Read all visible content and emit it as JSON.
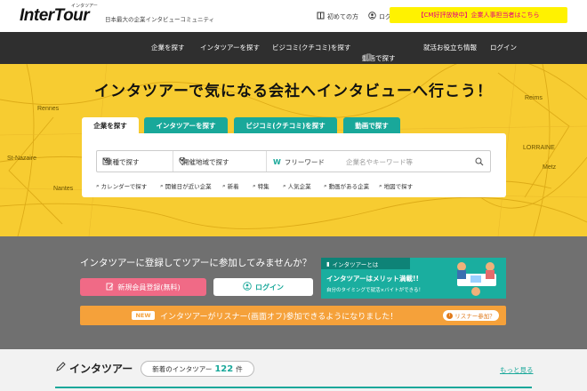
{
  "header": {
    "logo": "InterTour",
    "logo_sub": "インタツアー",
    "tagline": "日本最大の企業インタビューコミュニティ",
    "first_time": "初めての方",
    "login": "ログイン",
    "cm": "【CM好評放映中】企業人事担当者はこちら"
  },
  "nav": {
    "items": [
      "企業を探す",
      "インタツアーを探す",
      "ビジコミ(クチコミ)を探す",
      "動画で探す",
      "就活お役立ち情報",
      "ログイン"
    ]
  },
  "hero": {
    "headline": "インタツアーで気になる会社へインタビューへ行こう！",
    "tabs": [
      "企業を探す",
      "インタツアーを探す",
      "ビジコミ(クチコミ)を探す",
      "動画で探す"
    ],
    "industry": "業種で探す",
    "region": "開催地域で探す",
    "keyword": "フリーワード",
    "placeholder": "企業名やキーワード等",
    "quick_links": [
      "カレンダーで探す",
      "開催日が近い企業",
      "新着",
      "特集",
      "人気企業",
      "動画がある企業",
      "地図で探す"
    ],
    "map_labels": [
      "Rennes",
      "LORRAINE",
      "St-Nazaire",
      "Nantes",
      "Reims",
      "Metz"
    ]
  },
  "register": {
    "text": "インタツアーに登録してツアーに参加してみませんか？",
    "signup": "新規会員登録(無料)",
    "login": "ログイン",
    "promo_tag": "インタツアーとは",
    "promo_head": "インタツアーはメリット満載!!",
    "promo_sub": "自分のタイミングで就活×バイトができる！",
    "new_badge": "NEW",
    "listener_text": "インタツアーがリスナー(画面オフ)参加できるようになりました！",
    "listener_btn": "リスナー参加？"
  },
  "tours": {
    "title": "インタツアー",
    "new_prefix": "新着のインタツアー",
    "count": "122",
    "unit": "件",
    "more": "もっと見る"
  }
}
